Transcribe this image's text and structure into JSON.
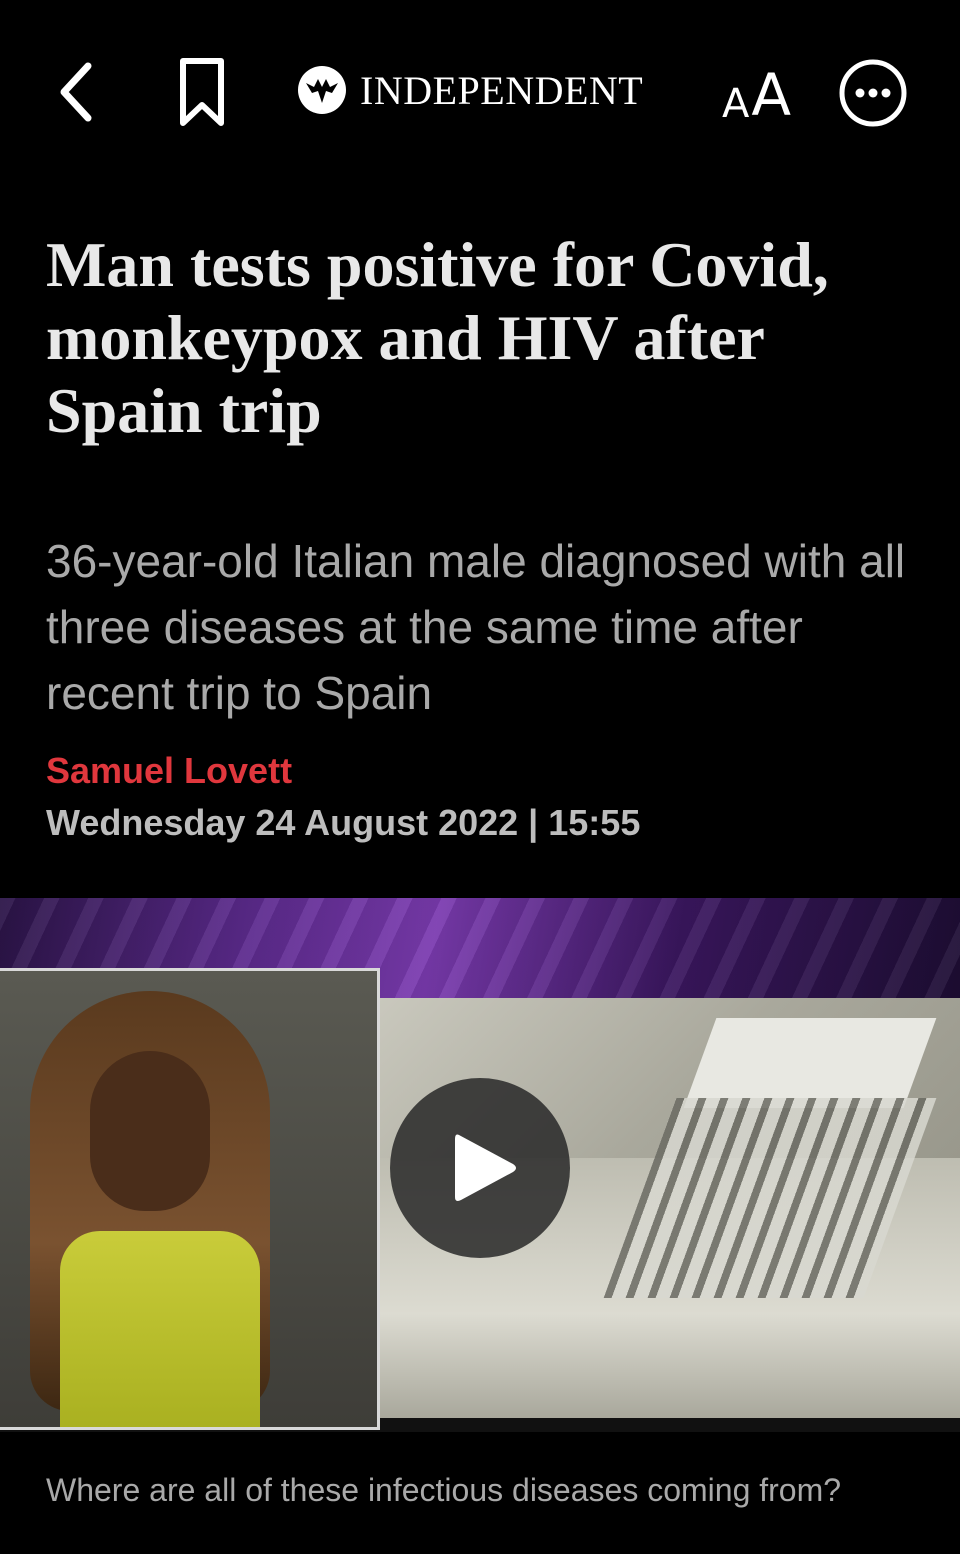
{
  "topbar": {
    "icons": {
      "back": "chevron-left-icon",
      "bookmark": "bookmark-icon",
      "logo": "eagle-logo-icon",
      "more": "more-icon"
    },
    "logo_text": "INDEPENDENT",
    "text_size": {
      "small": "A",
      "large": "A"
    }
  },
  "article": {
    "headline": "Man tests positive for Covid, monkeypox and HIV after Spain trip",
    "standfirst": "36-year-old Italian male diagnosed with all three diseases at the same time after recent trip to Spain",
    "author": "Samuel Lovett",
    "dateline": "Wednesday 24 August 2022 | 15:55"
  },
  "video": {
    "caption": "Where are all of these infectious diseases coming from?",
    "play_icon": "play-icon"
  },
  "colors": {
    "background": "#000000",
    "author": "#e0373d",
    "headline": "#e8e8e8",
    "standfirst": "#a9a9a9"
  }
}
